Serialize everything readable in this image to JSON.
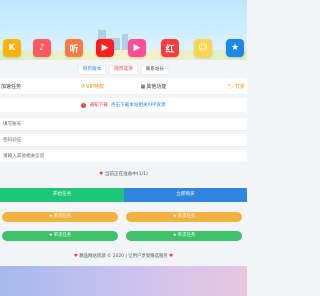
{
  "apps": [
    {
      "icon": "kugou-icon",
      "glyph": "K",
      "color": "#ffb300"
    },
    {
      "icon": "quanmin-kge-icon",
      "glyph": "♪",
      "color": "#ff5a5f"
    },
    {
      "icon": "ting-icon",
      "glyph": "听",
      "color": "#ff7a45"
    },
    {
      "icon": "youtube-icon",
      "glyph": "▶",
      "color": "#ff1e1e"
    },
    {
      "icon": "video-play-icon",
      "glyph": "▶",
      "color": "#ff4d9a"
    },
    {
      "icon": "red-logo-icon",
      "glyph": "红",
      "color": "#ff3b3b"
    },
    {
      "icon": "cartoon-icon",
      "glyph": "☺",
      "color": "#ffd54f"
    },
    {
      "icon": "star-icon",
      "glyph": "★",
      "color": "#1e88e5"
    }
  ],
  "chips": [
    "网页版本",
    "网页选项",
    "联系站长"
  ],
  "tabs": {
    "left": "加速任务",
    "middle": "VIP特权",
    "right": "其他功能",
    "far_right": "打折"
  },
  "notice": {
    "dot": "!",
    "label": "通知下载",
    "text": "点击下载本站相关APP资源"
  },
  "fields": {
    "account": "填写账号",
    "password": "密码验证",
    "extra": "请输入其他相关信息"
  },
  "status_line": "当前正在准备中(1/1)",
  "buttons": {
    "start": "开始任务",
    "buy": "立即购买"
  },
  "pills": [
    "单次任务",
    "单次任务",
    "单次任务",
    "单次任务"
  ],
  "footer": "精品网站资源 © 2020 | 让用户享受精选服务",
  "colors": {
    "green": "#1ec778",
    "blue": "#2f86e0",
    "orange": "#f3b13f",
    "pill_green": "#3ec16b",
    "banner_top": "#bfe6ff",
    "bottom_start": "#a5b8ee",
    "bottom_end": "#e9c7e2"
  }
}
